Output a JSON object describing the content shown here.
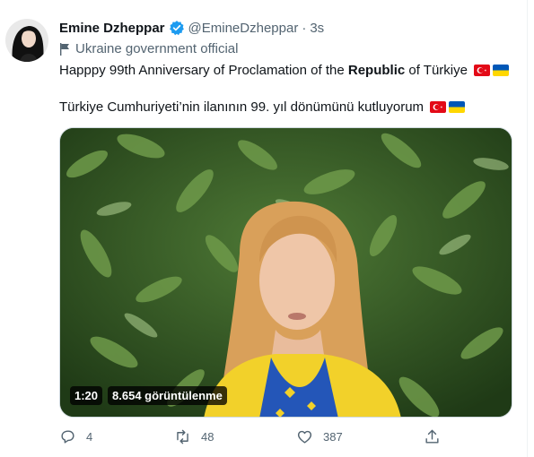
{
  "author": {
    "name": "Emine Dzheppar",
    "handle": "@EmineDzheppar",
    "separator": "·",
    "time": "3s",
    "affiliation": "Ukraine government official"
  },
  "tweet": {
    "line1_pre": "Happpy 99th Anniversary of Proclamation of the ",
    "line1_bold": "Republic",
    "line1_post": " of Türkiye",
    "line2": "Türkiye Cumhuriyeti’nin ilanının 99. yıl dönümünü kutluyorum"
  },
  "video": {
    "duration": "1:20",
    "views": "8.654 görüntülenme"
  },
  "actions": {
    "replies": "4",
    "retweets": "48",
    "likes": "387"
  },
  "colors": {
    "verified": "#1d9bf0",
    "turkey_red": "#e30a17",
    "ukraine_blue": "#0057b7",
    "ukraine_yellow": "#ffd700"
  },
  "icons": [
    "verified-badge-icon",
    "flag-icon",
    "reply-icon",
    "retweet-icon",
    "like-icon",
    "share-icon"
  ]
}
